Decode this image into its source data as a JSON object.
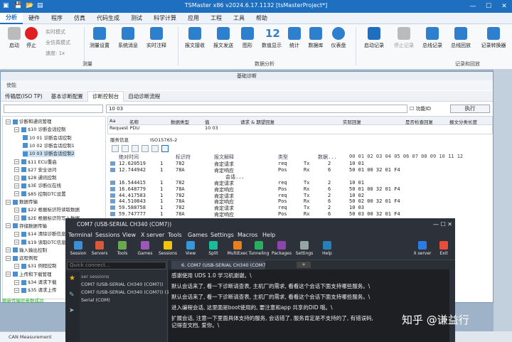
{
  "window": {
    "title": "TSMaster x86 v2024.6.17.1132 [tsMasterProject*]",
    "controls": [
      "—",
      "☐",
      "✕"
    ]
  },
  "menu": [
    "分析",
    "硬件",
    "程序",
    "仿真",
    "代码生成",
    "测试",
    "科学计算",
    "应用",
    "工程",
    "工具",
    "帮助"
  ],
  "ribbon": {
    "start": "启动",
    "stop": "停止",
    "realtime": "实时模式",
    "fullspeed": "全仿真模式",
    "speed": "速度: 1x",
    "measure_setup": "测量设置",
    "sys_msg": "系统消息",
    "realtime_note": "实时注释",
    "group_measure": "测量",
    "msg_send": "报文接收",
    "msg_tx": "报文发送",
    "graph": "图形",
    "num_display": "数值显示",
    "num_display_val": "12",
    "stats": "统计",
    "database": "数据库",
    "dashboard": "仪表盘",
    "group_analysis": "数据分析",
    "rec_start": "启动记录",
    "rec_stop": "停止记录",
    "bus_record": "总线记录",
    "bus_replay": "总线回放",
    "log_convert": "记录转换器",
    "group_record": "记录和回放"
  },
  "diag": {
    "title": "基础诊断",
    "toolbar1": "使能",
    "tabs": [
      "传输层(ISO TP)",
      "基本诊断配置",
      "诊断控制台",
      "自动诊断流程"
    ],
    "input_value": "10 03",
    "func_id": "功能ID",
    "execute": "执行",
    "tree": [
      {
        "t": "诊断和通讯管理"
      },
      {
        "t": "$10 诊断会话控制"
      },
      {
        "t": "10 01 诊断会话控制"
      },
      {
        "t": "10 02 诊断会话控制1"
      },
      {
        "t": "10 03 诊断会话控制2"
      },
      {
        "t": "$11 ECU重启"
      },
      {
        "t": "$27 安全访问"
      },
      {
        "t": "$28 通讯控制"
      },
      {
        "t": "$3E 诊断仪在线"
      },
      {
        "t": "$85 控制DTC设置"
      },
      {
        "t": "数据传输"
      },
      {
        "t": "$22 根据标识符读取数据"
      },
      {
        "t": "$2E 根据标识符写入数据"
      },
      {
        "t": "存储数据传输"
      },
      {
        "t": "$14 清除诊断信息"
      },
      {
        "t": "$19 读取DTC信息"
      },
      {
        "t": "输入输出控制"
      },
      {
        "t": "远程例程"
      },
      {
        "t": "$31 例程控制"
      },
      {
        "t": "上传和下载管理"
      },
      {
        "t": "$34 请求下载"
      },
      {
        "t": "$35 请求上传"
      }
    ],
    "status": "刷新传输层参数成功",
    "grid_head": [
      "Aa",
      "名称",
      "数据类型",
      "值",
      "请求 & 期望回复",
      "实际回复",
      "是否检查回复",
      "报文分类长度"
    ],
    "grid_row": [
      "Request PDU",
      "10 03"
    ],
    "svc_tab1": "服务信息",
    "svc_tab2": "ISO15765-2",
    "log_head": {
      "time": "绝对时间",
      "id": "标识符",
      "desc": "报文解释",
      "type": "类型",
      "dir": "数据...",
      "bytes": "00 01 02 03 04 05 06 07 08 09 10 11 12"
    },
    "log": [
      {
        "time": "12.620519",
        "ch": "1",
        "id": "782",
        "desc": "肯定请求",
        "type": "req",
        "dir": "Tx",
        "len": "2",
        "data": "10 01"
      },
      {
        "time": "12.744942",
        "ch": "1",
        "id": "78A",
        "desc": "肯定响应",
        "type": "Pos",
        "dir": "Rx",
        "len": "6",
        "data": "50 01 00 32 01 F4"
      },
      {
        "time": "",
        "ch": "",
        "id": "",
        "desc": "会话...",
        "type": "",
        "dir": "",
        "len": "",
        "data": ""
      },
      {
        "time": "16.544415",
        "ch": "1",
        "id": "782",
        "desc": "肯定请求",
        "type": "req",
        "dir": "Tx",
        "len": "2",
        "data": "10 01"
      },
      {
        "time": "16.648779",
        "ch": "1",
        "id": "78A",
        "desc": "肯定响应",
        "type": "Pos",
        "dir": "Rx",
        "len": "6",
        "data": "50 01 00 32 01 F4"
      },
      {
        "time": "44.417583",
        "ch": "1",
        "id": "782",
        "desc": "肯定请求",
        "type": "req",
        "dir": "Tx",
        "len": "2",
        "data": "10 02"
      },
      {
        "time": "44.510843",
        "ch": "1",
        "id": "78A",
        "desc": "肯定响应",
        "type": "Pos",
        "dir": "Rx",
        "len": "6",
        "data": "50 02 00 32 01 F4"
      },
      {
        "time": "59.588758",
        "ch": "1",
        "id": "782",
        "desc": "肯定请求",
        "type": "req",
        "dir": "Tx",
        "len": "2",
        "data": "10 03"
      },
      {
        "time": "59.747777",
        "ch": "1",
        "id": "78A",
        "desc": "肯定响应",
        "type": "Pos",
        "dir": "Rx",
        "len": "6",
        "data": "50 03 00 32 01 F4"
      }
    ]
  },
  "moba": {
    "title": "COM7  (USB-SERIAL CH340 (COM7))",
    "menu": [
      "Terminal",
      "Sessions",
      "View",
      "X server",
      "Tools",
      "Games",
      "Settings",
      "Macros",
      "Help"
    ],
    "toolbar": [
      "Session",
      "Servers",
      "Tools",
      "Games",
      "Sessions",
      "View",
      "Split",
      "MultiExec",
      "Tunneling",
      "Packages",
      "Settings",
      "Help",
      "X server",
      "Exit"
    ],
    "quick_connect": "Quick connect...",
    "sessions_label": "ser sessions",
    "sessions": [
      "COM7  (USB-SERIAL CH340 (COM7))",
      "COM7  (USB-SERIAL CH340 (COM7)) (1)",
      "Serial (COM)"
    ],
    "tab": "6. COM7  (USB-SERIAL CH340 (COM7))",
    "tab_plus": "+",
    "lines": [
      "感谢使用 UDS 1.0 学习机谢谢。\\",
      "默认会话来了, 看一下诊断请查表, 主机厂的需求, 看看这个会话下面支持哪些服务。\\",
      "默认会话来了, 看一下诊断请查表, 主机厂的需求, 看看这个会话下面支持哪些服务。\\",
      "进入编程会话, 这里面是boot使用的, 要注意和app 共享的DID 哦。\\",
      "扩展会话, 注意一下里面具体支持的服务, 会话错了, 服务肯定是不支持的了, 有错误码,",
      "记得查文档, 爱你。\\"
    ]
  },
  "bottom": {
    "tab": "CAN Measurement"
  },
  "watermark": "知乎 @谦益行"
}
